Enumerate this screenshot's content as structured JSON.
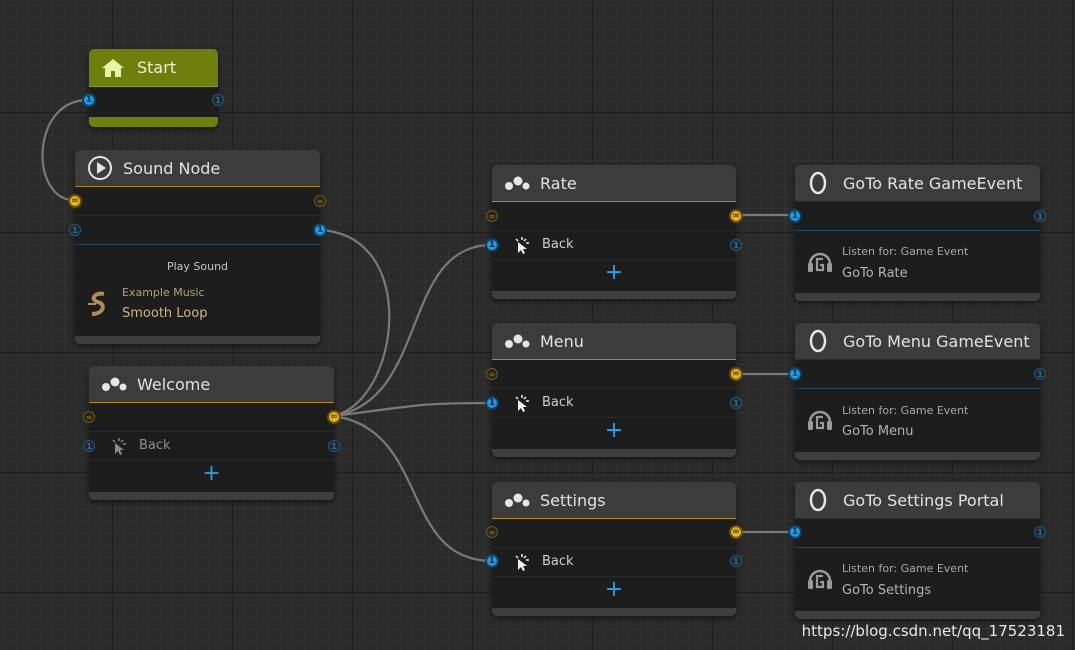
{
  "nodes": {
    "start": {
      "title": "Start"
    },
    "sound": {
      "title": "Sound Node",
      "action_label": "Play Sound",
      "asset_type": "Example Music",
      "asset_name": "Smooth Loop"
    },
    "welcome": {
      "title": "Welcome",
      "back_label": "Back"
    },
    "rate": {
      "title": "Rate",
      "back_label": "Back"
    },
    "menu": {
      "title": "Menu",
      "back_label": "Back"
    },
    "settings": {
      "title": "Settings",
      "back_label": "Back"
    },
    "goto_rate": {
      "title": "GoTo Rate GameEvent",
      "listen_label": "Listen for: Game Event",
      "event_name": "GoTo Rate"
    },
    "goto_menu": {
      "title": "GoTo Menu GameEvent",
      "listen_label": "Listen for: Game Event",
      "event_name": "GoTo Menu"
    },
    "goto_settings": {
      "title": "GoTo Settings Portal",
      "listen_label": "Listen for: Game Event",
      "event_name": "GoTo Settings"
    }
  },
  "port_glyphs": {
    "connection": "1",
    "output": "∞"
  },
  "add_glyph": "+",
  "icons": {
    "start": "home-icon",
    "sound": "play-icon",
    "ui_node": "ui-nodes-icon",
    "back": "cursor-click-icon",
    "portal": "portal-ring-icon",
    "listener": "game-event-icon",
    "music": "sound-asset-icon"
  },
  "colors": {
    "canvas": "#2b2b2b",
    "start_header": "#6e7f0e",
    "port_blue": "#1e9ae0",
    "port_yellow": "#e7b51a",
    "wire": "#7a7a7a"
  },
  "watermark": "https://blog.csdn.net/qq_17523181"
}
